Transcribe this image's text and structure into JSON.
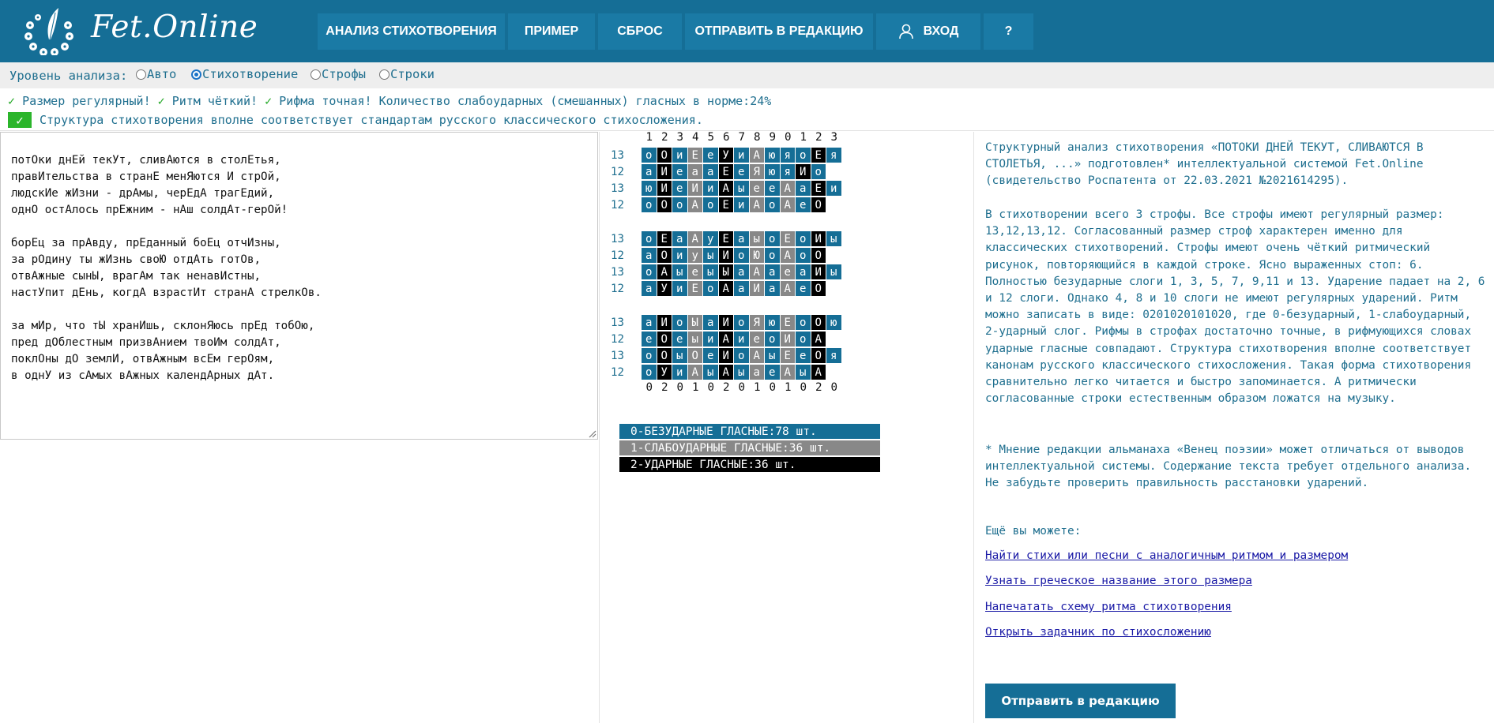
{
  "header": {
    "brand": "Fet.Online",
    "nav": [
      {
        "id": "analysis",
        "label": "АНАЛИЗ СТИХОТВОРЕНИЯ"
      },
      {
        "id": "example",
        "label": "ПРИМЕР"
      },
      {
        "id": "reset",
        "label": "СБРОС"
      },
      {
        "id": "submit",
        "label": "ОТПРАВИТЬ В РЕДАКЦИЮ"
      },
      {
        "id": "login",
        "label": "ВХОД",
        "icon": "user-icon"
      },
      {
        "id": "help",
        "label": "?"
      }
    ]
  },
  "analysis_level": {
    "label": "Уровень анализа:",
    "options": [
      "Авто",
      "Стихотворение",
      "Строфы",
      "Строки"
    ],
    "selected": "Стихотворение"
  },
  "status": {
    "meter": "Размер регулярный!",
    "rhythm": "Ритм чёткий!",
    "rhyme": "Рифма точная! Количество слабоударных (смешанных) гласных в норме:24%",
    "structure": "Структура стихотворения вполне соответствует стандартам русского классического стихосложения.",
    "colors": {
      "check": "#22a825",
      "box": "#2bb52b"
    }
  },
  "poem": {
    "lines": [
      "потОки днЕй текУт, сливАются в столЕтья,",
      "правИтельства в странЕ менЯются И стрОй,",
      "людскИе жИзни - дрАмы, черЕдА трагЕдий,",
      "однО остАлось прЕжним - нАш солдАт-герОй!",
      "",
      "борЕц за прАвду, прЕданный боЕц отчИзны,",
      "за рОдину ты жИзнь своЮ отдАть готОв,",
      "отвАжные сынЫ, врагАм так ненавИстны,",
      "настУпит дЕнь, когдА взрастИт странА стрелкОв.",
      "",
      "за мИр, что тЫ хранИшь, склонЯюсь прЕд тобОю,",
      "пред дОблестным призвАнием твоИм солдАт,",
      "поклОны дО землИ, отвАжным всЕм герОям,",
      "в однУ из сАмых вАжных календАрных дАт."
    ]
  },
  "rhythm": {
    "column_numbers": [
      "1",
      "2",
      "3",
      "4",
      "5",
      "6",
      "7",
      "8",
      "9",
      "0",
      "1",
      "2",
      "3"
    ],
    "stanzas": [
      [
        {
          "count": "13",
          "cells": [
            [
              "о",
              0
            ],
            [
              "О",
              2
            ],
            [
              "и",
              0
            ],
            [
              "Е",
              1
            ],
            [
              "е",
              0
            ],
            [
              "У",
              2
            ],
            [
              "и",
              0
            ],
            [
              "А",
              1
            ],
            [
              "ю",
              0
            ],
            [
              "я",
              0
            ],
            [
              "о",
              0
            ],
            [
              "Е",
              2
            ],
            [
              "я",
              0
            ]
          ]
        },
        {
          "count": "12",
          "cells": [
            [
              "а",
              0
            ],
            [
              "И",
              2
            ],
            [
              "е",
              0
            ],
            [
              "а",
              1
            ],
            [
              "а",
              0
            ],
            [
              "Е",
              2
            ],
            [
              "е",
              0
            ],
            [
              "Я",
              1
            ],
            [
              "ю",
              0
            ],
            [
              "я",
              0
            ],
            [
              "И",
              2
            ],
            [
              "о",
              0
            ]
          ]
        },
        {
          "count": "13",
          "cells": [
            [
              "ю",
              0
            ],
            [
              "И",
              2
            ],
            [
              "е",
              0
            ],
            [
              "И",
              1
            ],
            [
              "и",
              0
            ],
            [
              "А",
              2
            ],
            [
              "ы",
              0
            ],
            [
              "е",
              1
            ],
            [
              "е",
              0
            ],
            [
              "А",
              1
            ],
            [
              "а",
              0
            ],
            [
              "Е",
              2
            ],
            [
              "и",
              0
            ]
          ]
        },
        {
          "count": "12",
          "cells": [
            [
              "о",
              0
            ],
            [
              "О",
              2
            ],
            [
              "о",
              0
            ],
            [
              "А",
              1
            ],
            [
              "о",
              0
            ],
            [
              "Е",
              2
            ],
            [
              "и",
              0
            ],
            [
              "А",
              1
            ],
            [
              "о",
              0
            ],
            [
              "А",
              1
            ],
            [
              "е",
              0
            ],
            [
              "О",
              2
            ]
          ]
        }
      ],
      [
        {
          "count": "13",
          "cells": [
            [
              "о",
              0
            ],
            [
              "Е",
              2
            ],
            [
              "а",
              0
            ],
            [
              "А",
              1
            ],
            [
              "у",
              0
            ],
            [
              "Е",
              2
            ],
            [
              "а",
              0
            ],
            [
              "ы",
              1
            ],
            [
              "о",
              0
            ],
            [
              "Е",
              1
            ],
            [
              "о",
              0
            ],
            [
              "И",
              2
            ],
            [
              "ы",
              0
            ]
          ]
        },
        {
          "count": "12",
          "cells": [
            [
              "а",
              0
            ],
            [
              "О",
              2
            ],
            [
              "и",
              0
            ],
            [
              "у",
              1
            ],
            [
              "ы",
              0
            ],
            [
              "И",
              2
            ],
            [
              "о",
              0
            ],
            [
              "Ю",
              1
            ],
            [
              "о",
              0
            ],
            [
              "А",
              1
            ],
            [
              "о",
              0
            ],
            [
              "О",
              2
            ]
          ]
        },
        {
          "count": "13",
          "cells": [
            [
              "о",
              0
            ],
            [
              "А",
              2
            ],
            [
              "ы",
              0
            ],
            [
              "е",
              1
            ],
            [
              "ы",
              0
            ],
            [
              "Ы",
              2
            ],
            [
              "а",
              0
            ],
            [
              "А",
              1
            ],
            [
              "а",
              0
            ],
            [
              "е",
              1
            ],
            [
              "а",
              0
            ],
            [
              "И",
              2
            ],
            [
              "ы",
              0
            ]
          ]
        },
        {
          "count": "12",
          "cells": [
            [
              "а",
              0
            ],
            [
              "У",
              2
            ],
            [
              "и",
              0
            ],
            [
              "Е",
              1
            ],
            [
              "о",
              0
            ],
            [
              "А",
              2
            ],
            [
              "а",
              0
            ],
            [
              "И",
              1
            ],
            [
              "а",
              0
            ],
            [
              "А",
              1
            ],
            [
              "е",
              0
            ],
            [
              "О",
              2
            ]
          ]
        }
      ],
      [
        {
          "count": "13",
          "cells": [
            [
              "а",
              0
            ],
            [
              "И",
              2
            ],
            [
              "о",
              0
            ],
            [
              "Ы",
              1
            ],
            [
              "а",
              0
            ],
            [
              "И",
              2
            ],
            [
              "о",
              0
            ],
            [
              "Я",
              1
            ],
            [
              "ю",
              0
            ],
            [
              "Е",
              1
            ],
            [
              "о",
              0
            ],
            [
              "О",
              2
            ],
            [
              "ю",
              0
            ]
          ]
        },
        {
          "count": "12",
          "cells": [
            [
              "е",
              0
            ],
            [
              "О",
              2
            ],
            [
              "е",
              0
            ],
            [
              "ы",
              1
            ],
            [
              "и",
              0
            ],
            [
              "А",
              2
            ],
            [
              "и",
              0
            ],
            [
              "е",
              1
            ],
            [
              "о",
              0
            ],
            [
              "И",
              1
            ],
            [
              "о",
              0
            ],
            [
              "А",
              2
            ]
          ]
        },
        {
          "count": "13",
          "cells": [
            [
              "о",
              0
            ],
            [
              "О",
              2
            ],
            [
              "ы",
              0
            ],
            [
              "О",
              1
            ],
            [
              "е",
              0
            ],
            [
              "И",
              2
            ],
            [
              "о",
              0
            ],
            [
              "А",
              1
            ],
            [
              "ы",
              0
            ],
            [
              "Е",
              1
            ],
            [
              "е",
              0
            ],
            [
              "О",
              2
            ],
            [
              "я",
              0
            ]
          ]
        },
        {
          "count": "12",
          "cells": [
            [
              "о",
              0
            ],
            [
              "У",
              2
            ],
            [
              "и",
              0
            ],
            [
              "А",
              1
            ],
            [
              "ы",
              0
            ],
            [
              "А",
              2
            ],
            [
              "ы",
              0
            ],
            [
              "а",
              1
            ],
            [
              "е",
              0
            ],
            [
              "А",
              1
            ],
            [
              "ы",
              0
            ],
            [
              "А",
              2
            ]
          ]
        }
      ]
    ],
    "pattern_digits": [
      "0",
      "2",
      "0",
      "1",
      "0",
      "2",
      "0",
      "1",
      "0",
      "1",
      "0",
      "2",
      "0"
    ],
    "legend": [
      {
        "label": "0-БЕЗУДАРНЫЕ ГЛАСНЫЕ:78 шт.",
        "color": "#156e96"
      },
      {
        "label": "1-СЛАБОУДАРНЫЕ ГЛАСНЫЕ:36 шт.",
        "color": "#888888"
      },
      {
        "label": "2-УДАРНЫЕ ГЛАСНЫЕ:36 шт.",
        "color": "#000000"
      }
    ]
  },
  "report": {
    "intro": "Структурный анализ стихотворения «ПОТОКИ ДНЕЙ ТЕКУТ, СЛИВАЮТСЯ В СТОЛЕТЬЯ, ...» подготовлен* интеллектуальной системой Fet.Online (свидетельство Роспатента от 22.03.2021 №2021614295).",
    "body": "В стихотворении всего 3 строфы. Все строфы имеют регулярный размер: 13,12,13,12. Согласованный размер строф характерен именно для классических стихотворений. Строфы имеют очень чёткий ритмический рисунок, повторяющийся в каждой строке. Ясно выраженных стоп: 6. Полностью безударные слоги 1, 3, 5, 7, 9,11 и 13. Ударение падает на 2, 6 и 12 слоги. Однако 4, 8 и 10 слоги не имеют регулярных ударений. Ритм можно записать в виде: 0201020101020, где 0-безударный, 1-слабоударный, 2-ударный слог. Рифмы в строфах достаточно точные, в рифмующихся словах ударные гласные совпадают. Структура стихотворения вполне соответствует канонам русского классического стихосложения. Такая форма стихотворения сравнительно легко читается и быстро запоминается. А ритмически согласованные строки естественным образом ложатся на музыку.",
    "note": "* Мнение редакции альманаха «Венец поэзии» может отличаться от выводов интеллектуальной системы. Содержание текста требует отдельного анализа. Не забудьте проверить правильность расстановки ударений.",
    "more_title": "Ещё вы можете:",
    "links": [
      "Найти стихи или песни с аналогичным ритмом и размером",
      "Узнать греческое название этого размера",
      "Напечатать схему ритма стихотворения",
      "Открыть задачник по стихосложению"
    ],
    "send_button": "Отправить в редакцию"
  }
}
